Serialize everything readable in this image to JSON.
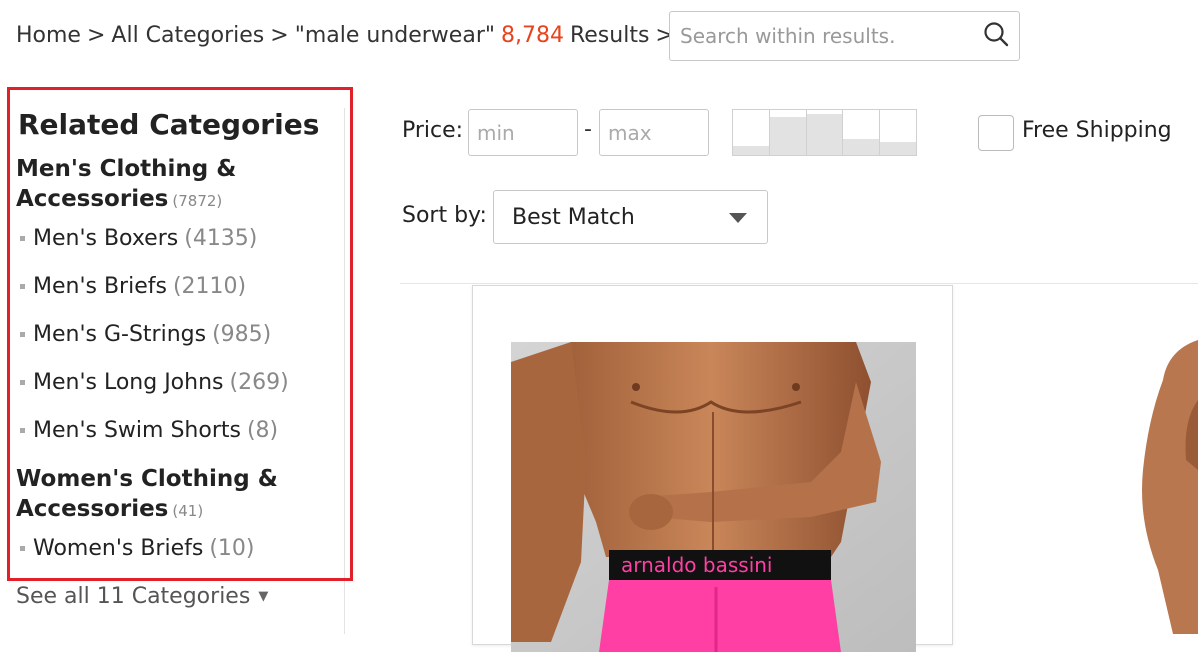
{
  "breadcrumb": {
    "home": "Home",
    "sep": ">",
    "all_categories": "All Categories",
    "query": "\"male underwear\"",
    "count": "8,784",
    "results_label": "Results"
  },
  "search": {
    "placeholder": "Search within results.",
    "icon": "search-icon"
  },
  "sidebar": {
    "title": "Related Categories",
    "groups": [
      {
        "title": "Men's Clothing & Accessories",
        "count": "(7872)",
        "items": [
          {
            "label": "Men's Boxers",
            "count": "(4135)"
          },
          {
            "label": "Men's Briefs",
            "count": "(2110)"
          },
          {
            "label": "Men's G-Strings",
            "count": "(985)"
          },
          {
            "label": "Men's Long Johns",
            "count": "(269)"
          },
          {
            "label": "Men's Swim Shorts",
            "count": "(8)"
          }
        ]
      },
      {
        "title": "Women's Clothing & Accessories",
        "count": "(41)",
        "items": [
          {
            "label": "Women's Briefs",
            "count": "(10)"
          }
        ]
      }
    ],
    "see_all": "See all 11 Categories"
  },
  "filters": {
    "price_label": "Price:",
    "min_placeholder": "min",
    "dash": "-",
    "max_placeholder": "max",
    "histogram_levels": [
      0.2,
      0.85,
      0.92,
      0.35,
      0.3
    ],
    "free_shipping": "Free Shipping",
    "sort_label": "Sort by:",
    "sort_value": "Best Match"
  },
  "colors": {
    "accent": "#e8431c",
    "highlight_border": "#e2202a",
    "waistband_pink": "#ff3fa3"
  }
}
